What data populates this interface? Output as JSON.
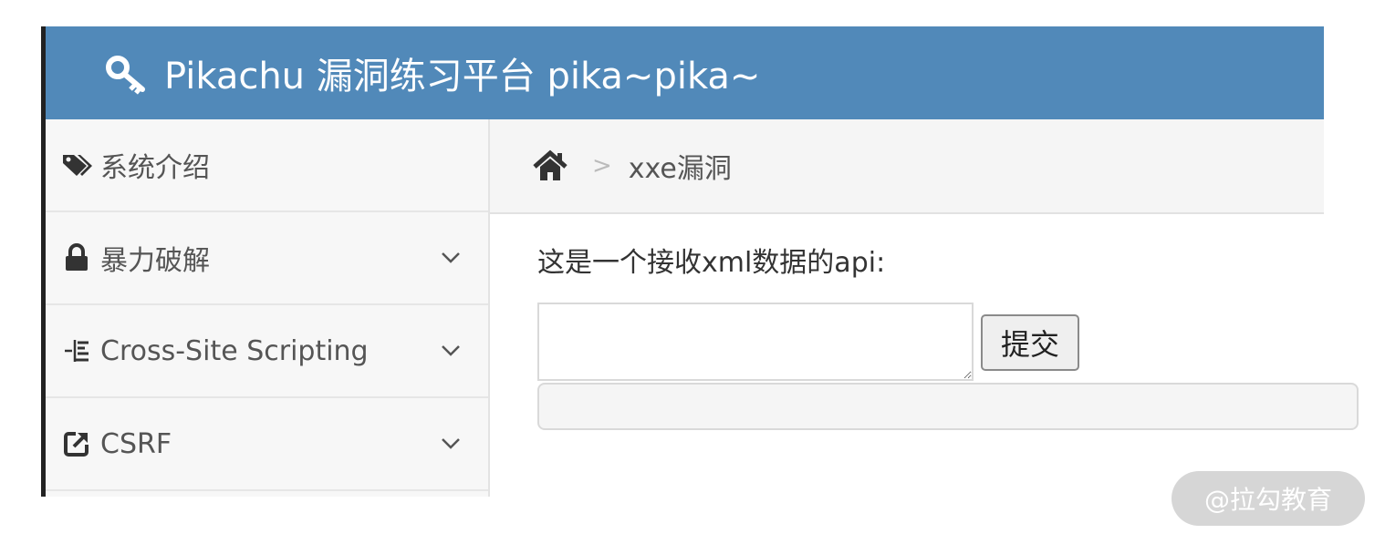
{
  "header": {
    "title": "Pikachu 漏洞练习平台 pika~pika~",
    "icon": "key-icon"
  },
  "sidebar": {
    "items": [
      {
        "label": "系统介绍",
        "icon": "tags-icon",
        "has_chevron": false
      },
      {
        "label": "暴力破解",
        "icon": "lock-icon",
        "has_chevron": true
      },
      {
        "label": "Cross-Site Scripting",
        "icon": "indent-icon",
        "has_chevron": true
      },
      {
        "label": "CSRF",
        "icon": "share-square-icon",
        "has_chevron": true
      }
    ]
  },
  "breadcrumb": {
    "home_icon": "home-icon",
    "separator": ">",
    "current": "xxe漏洞"
  },
  "main": {
    "description": "这是一个接收xml数据的api:",
    "input_value": "",
    "submit_label": "提交",
    "result_text": ""
  },
  "watermark": {
    "text": "@拉勾教育"
  },
  "colors": {
    "header_bg": "#5189b9",
    "sidebar_bg": "#f7f7f7",
    "breadcrumb_bg": "#f5f5f5"
  }
}
